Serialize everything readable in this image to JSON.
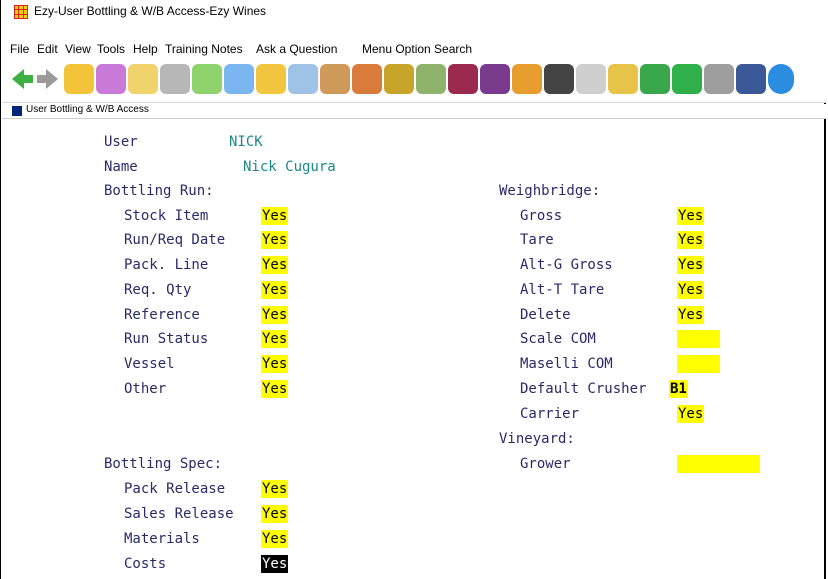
{
  "window": {
    "title": "Ezy-User Bottling & W/B Access-Ezy Wines"
  },
  "menu": [
    "File",
    "Edit",
    "View",
    "Tools",
    "Help",
    "Training Notes",
    "Ask a Question",
    "Menu Option Search"
  ],
  "toolbar_icons": [
    "back-arrow-icon",
    "forward-arrow-icon",
    "folder-icon",
    "files-icon",
    "pen-icon",
    "building-icon",
    "money-icon",
    "screen-icon",
    "people-icon",
    "wand-icon",
    "barrel-icon",
    "box-icon",
    "bottles-icon",
    "worker-icon",
    "wine-glass-icon",
    "grapes-icon",
    "briefcase-icon",
    "gear-icon",
    "blank-icon",
    "package-icon",
    "leaf-icon",
    "dollar-icon",
    "news-icon",
    "facebook-icon",
    "web-icon"
  ],
  "subwindow": {
    "title": "User Bottling & W/B Access"
  },
  "user": {
    "label": "User",
    "value": "NICK"
  },
  "name": {
    "label": "Name",
    "value": "Nick Cugura"
  },
  "bottling_run": {
    "heading": "Bottling Run:",
    "rows": [
      {
        "label": "Stock Item",
        "value": "Yes"
      },
      {
        "label": "Run/Req Date",
        "value": "Yes"
      },
      {
        "label": "Pack. Line",
        "value": "Yes"
      },
      {
        "label": "Req. Qty",
        "value": "Yes"
      },
      {
        "label": "Reference",
        "value": "Yes"
      },
      {
        "label": "Run Status",
        "value": "Yes"
      },
      {
        "label": "Vessel",
        "value": "Yes"
      },
      {
        "label": "Other",
        "value": "Yes"
      }
    ]
  },
  "bottling_spec": {
    "heading": "Bottling Spec:",
    "rows": [
      {
        "label": "Pack Release",
        "value": "Yes"
      },
      {
        "label": "Sales Release",
        "value": "Yes"
      },
      {
        "label": "Materials",
        "value": "Yes"
      },
      {
        "label": "Costs",
        "value": "Yes"
      }
    ]
  },
  "weighbridge": {
    "heading": "Weighbridge:",
    "rows": [
      {
        "label": "Gross",
        "value": "Yes"
      },
      {
        "label": "Tare",
        "value": "Yes"
      },
      {
        "label": "Alt-G Gross",
        "value": "Yes"
      },
      {
        "label": "Alt-T Tare",
        "value": "Yes"
      },
      {
        "label": "Delete",
        "value": "Yes"
      },
      {
        "label": "Scale COM",
        "value": ""
      },
      {
        "label": "Maselli COM",
        "value": ""
      },
      {
        "label": "Default Crusher",
        "value": "B1"
      },
      {
        "label": "Carrier",
        "value": "Yes"
      }
    ]
  },
  "vineyard": {
    "heading": "Vineyard:",
    "rows": [
      {
        "label": "Grower",
        "value": ""
      }
    ]
  },
  "colors": {
    "label": "#2a2a6a",
    "value_teal": "#1a8a8a",
    "field_yellow": "#ffff00",
    "selected_bg": "#000000"
  }
}
